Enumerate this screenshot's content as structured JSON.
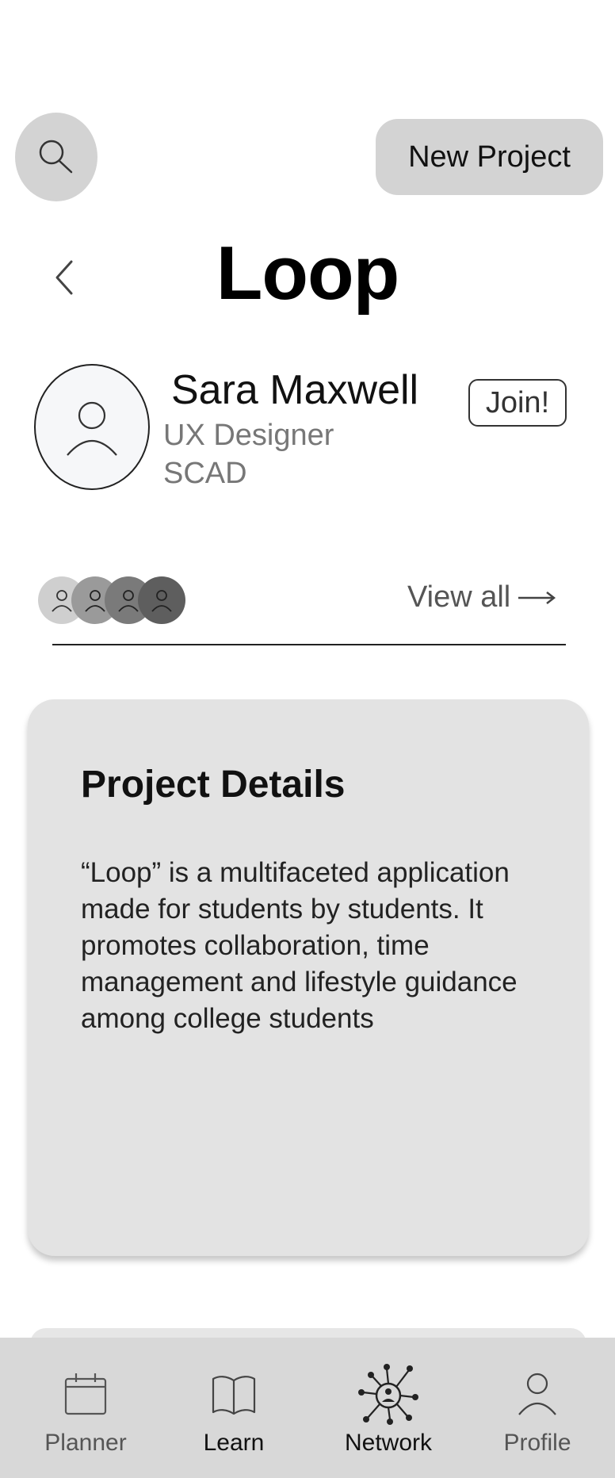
{
  "header": {
    "search_icon": "search-icon",
    "new_project_label": "New Project"
  },
  "title_row": {
    "back_icon": "chevron-left-icon",
    "title": "Loop"
  },
  "profile": {
    "name": "Sara Maxwell",
    "role": "UX Designer",
    "school": "SCAD",
    "join_label": "Join!"
  },
  "members": {
    "avatar_colors": [
      "#cfcfcf",
      "#9a9a9a",
      "#7a7a7a",
      "#5e5e5e"
    ],
    "view_all_label": "View all"
  },
  "project": {
    "heading": "Project Details",
    "description": "“Loop” is a multifaceted application made for students by students. It promotes collaboration, time management and lifestyle guidance among college students"
  },
  "nav": {
    "items": [
      {
        "label": "Planner",
        "icon": "calendar-icon"
      },
      {
        "label": "Learn",
        "icon": "book-icon"
      },
      {
        "label": "Network",
        "icon": "network-icon"
      },
      {
        "label": "Profile",
        "icon": "user-icon"
      }
    ]
  }
}
